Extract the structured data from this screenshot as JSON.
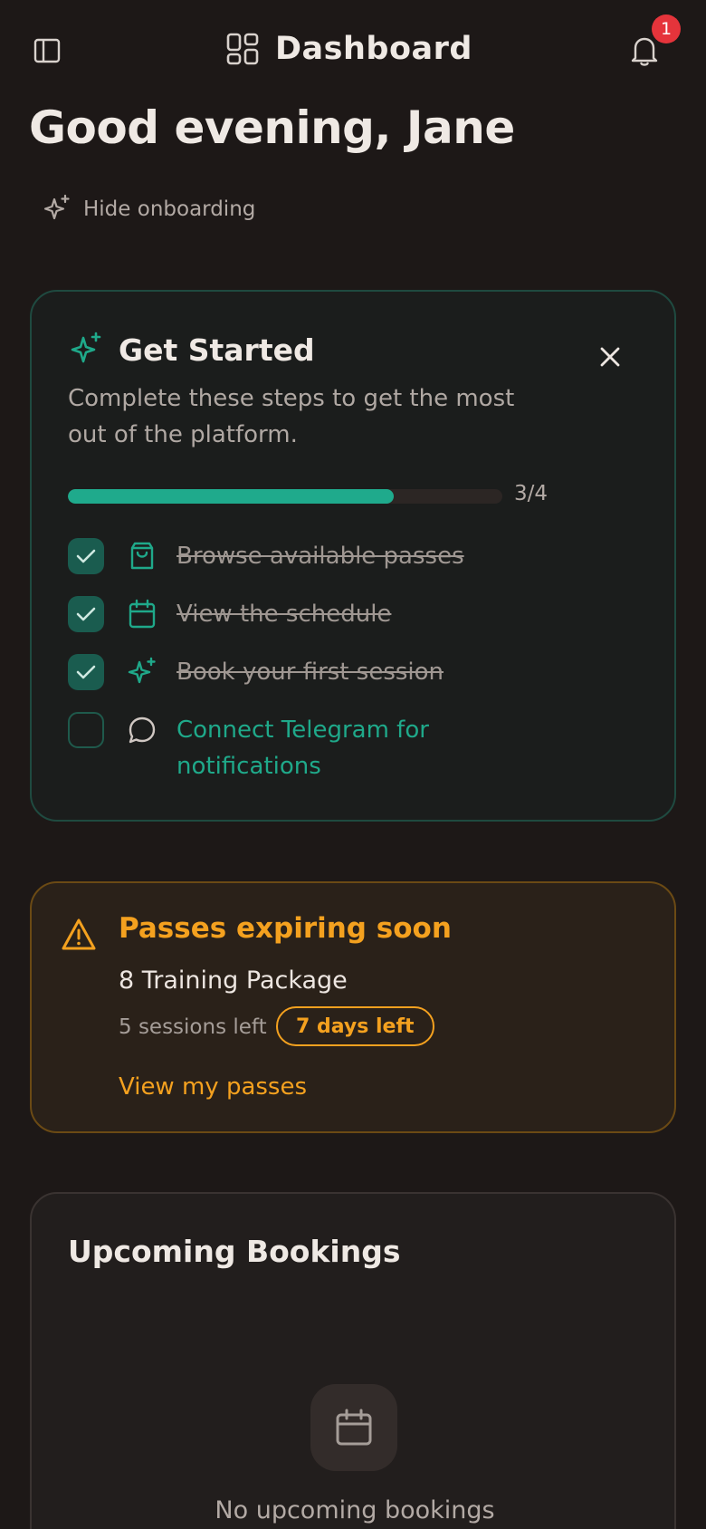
{
  "header": {
    "title": "Dashboard",
    "notification_count": "1"
  },
  "greeting": "Good evening, Jane",
  "hide_onboarding_label": "Hide onboarding",
  "get_started": {
    "title": "Get Started",
    "subtitle": "Complete these steps to get the most out of the platform.",
    "progress_label": "3/4",
    "progress_fraction": 0.75,
    "steps": [
      {
        "label": "Browse available passes",
        "done": true,
        "icon": "shopping-bag-icon"
      },
      {
        "label": "View the schedule",
        "done": true,
        "icon": "calendar-icon"
      },
      {
        "label": "Book your first session",
        "done": true,
        "icon": "sparkles-icon"
      },
      {
        "label": "Connect Telegram for notifications",
        "done": false,
        "icon": "chat-bubble-icon"
      }
    ]
  },
  "expiring": {
    "title": "Passes expiring soon",
    "package": "8 Training Package",
    "sessions_left": "5 sessions left",
    "days_left": "7 days left",
    "link": "View my passes"
  },
  "upcoming": {
    "title": "Upcoming Bookings",
    "empty_text": "No upcoming bookings"
  },
  "colors": {
    "background": "#1d1817",
    "accent_green": "#1faa8c",
    "warning_orange": "#f4a11f",
    "badge_red": "#e5343b"
  }
}
